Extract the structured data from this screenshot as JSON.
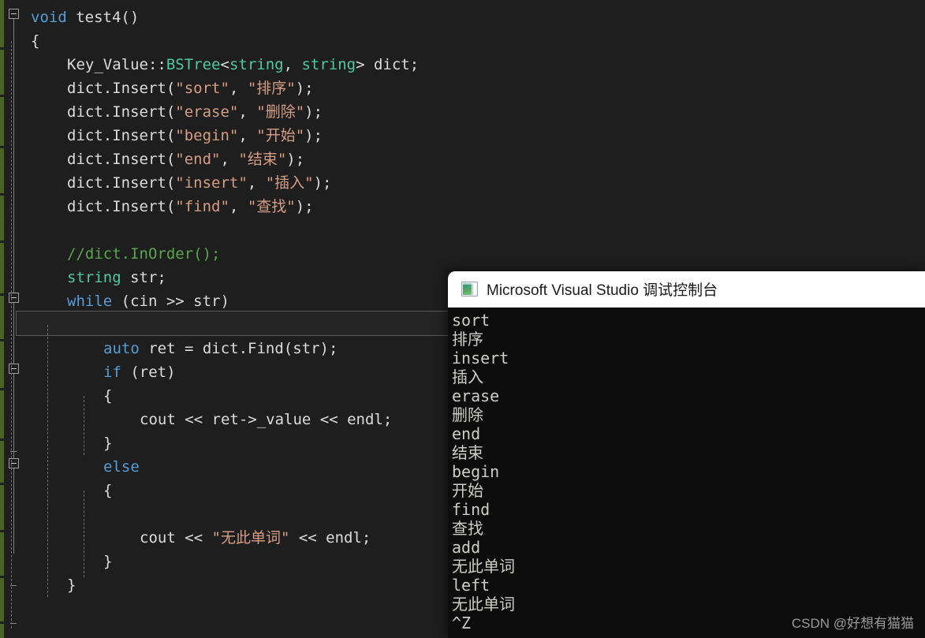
{
  "editor": {
    "name": "visual-studio-code-editor",
    "theme_colors": {
      "background": "#1e1e1e",
      "keyword": "#569cd6",
      "type": "#4ec9a0",
      "string": "#d69d85",
      "comment": "#57a64a",
      "plain": "#dcdcdc",
      "change_bar": "#4b6226",
      "current_line_border": "#5a5a5a"
    },
    "lines": [
      {
        "indent": 0,
        "tokens": [
          {
            "t": "void",
            "c": "kw"
          },
          {
            "t": " test4()",
            "c": "pln"
          }
        ]
      },
      {
        "indent": 0,
        "tokens": [
          {
            "t": "{",
            "c": "brc"
          }
        ]
      },
      {
        "indent": 1,
        "tokens": [
          {
            "t": "Key_Value::",
            "c": "pln"
          },
          {
            "t": "BSTree",
            "c": "typ"
          },
          {
            "t": "<",
            "c": "pln"
          },
          {
            "t": "string",
            "c": "typ"
          },
          {
            "t": ", ",
            "c": "pln"
          },
          {
            "t": "string",
            "c": "typ"
          },
          {
            "t": "> dict;",
            "c": "pln"
          }
        ]
      },
      {
        "indent": 1,
        "tokens": [
          {
            "t": "dict.Insert(",
            "c": "pln"
          },
          {
            "t": "\"sort\"",
            "c": "str"
          },
          {
            "t": ", ",
            "c": "pln"
          },
          {
            "t": "\"排序\"",
            "c": "str"
          },
          {
            "t": ");",
            "c": "pln"
          }
        ]
      },
      {
        "indent": 1,
        "tokens": [
          {
            "t": "dict.Insert(",
            "c": "pln"
          },
          {
            "t": "\"erase\"",
            "c": "str"
          },
          {
            "t": ", ",
            "c": "pln"
          },
          {
            "t": "\"删除\"",
            "c": "str"
          },
          {
            "t": ");",
            "c": "pln"
          }
        ]
      },
      {
        "indent": 1,
        "tokens": [
          {
            "t": "dict.Insert(",
            "c": "pln"
          },
          {
            "t": "\"begin\"",
            "c": "str"
          },
          {
            "t": ", ",
            "c": "pln"
          },
          {
            "t": "\"开始\"",
            "c": "str"
          },
          {
            "t": ");",
            "c": "pln"
          }
        ]
      },
      {
        "indent": 1,
        "tokens": [
          {
            "t": "dict.Insert(",
            "c": "pln"
          },
          {
            "t": "\"end\"",
            "c": "str"
          },
          {
            "t": ", ",
            "c": "pln"
          },
          {
            "t": "\"结束\"",
            "c": "str"
          },
          {
            "t": ");",
            "c": "pln"
          }
        ]
      },
      {
        "indent": 1,
        "tokens": [
          {
            "t": "dict.Insert(",
            "c": "pln"
          },
          {
            "t": "\"insert\"",
            "c": "str"
          },
          {
            "t": ", ",
            "c": "pln"
          },
          {
            "t": "\"插入\"",
            "c": "str"
          },
          {
            "t": ");",
            "c": "pln"
          }
        ]
      },
      {
        "indent": 1,
        "tokens": [
          {
            "t": "dict.Insert(",
            "c": "pln"
          },
          {
            "t": "\"find\"",
            "c": "str"
          },
          {
            "t": ", ",
            "c": "pln"
          },
          {
            "t": "\"查找\"",
            "c": "str"
          },
          {
            "t": ");",
            "c": "pln"
          }
        ]
      },
      {
        "indent": 0,
        "tokens": []
      },
      {
        "indent": 1,
        "tokens": [
          {
            "t": "//dict.InOrder();",
            "c": "cmt"
          }
        ]
      },
      {
        "indent": 1,
        "tokens": [
          {
            "t": "string",
            "c": "typ"
          },
          {
            "t": " str;",
            "c": "pln"
          }
        ]
      },
      {
        "indent": 1,
        "tokens": [
          {
            "t": "while",
            "c": "kw"
          },
          {
            "t": " (cin >> str)",
            "c": "pln"
          }
        ]
      },
      {
        "indent": 1,
        "tokens": [
          {
            "t": "{",
            "c": "brc"
          }
        ]
      },
      {
        "indent": 2,
        "tokens": [
          {
            "t": "auto",
            "c": "kw"
          },
          {
            "t": " ret = dict.Find(str);",
            "c": "pln"
          }
        ]
      },
      {
        "indent": 2,
        "tokens": [
          {
            "t": "if",
            "c": "kw"
          },
          {
            "t": " (ret)",
            "c": "pln"
          }
        ]
      },
      {
        "indent": 2,
        "tokens": [
          {
            "t": "{",
            "c": "brc"
          }
        ]
      },
      {
        "indent": 3,
        "tokens": [
          {
            "t": "cout << ret->_value << endl;",
            "c": "pln"
          }
        ]
      },
      {
        "indent": 2,
        "tokens": [
          {
            "t": "}",
            "c": "brc"
          }
        ]
      },
      {
        "indent": 2,
        "tokens": [
          {
            "t": "else",
            "c": "kw"
          }
        ]
      },
      {
        "indent": 2,
        "tokens": [
          {
            "t": "{",
            "c": "brc"
          }
        ]
      },
      {
        "indent": 0,
        "tokens": []
      },
      {
        "indent": 3,
        "tokens": [
          {
            "t": "cout << ",
            "c": "pln"
          },
          {
            "t": "\"无此单词\"",
            "c": "str"
          },
          {
            "t": " << endl;",
            "c": "pln"
          }
        ]
      },
      {
        "indent": 2,
        "tokens": [
          {
            "t": "}",
            "c": "brc"
          }
        ]
      },
      {
        "indent": 1,
        "tokens": [
          {
            "t": "}",
            "c": "brc"
          }
        ]
      }
    ],
    "current_line_index": 13,
    "collapse_boxes": [
      0,
      12,
      15,
      19
    ],
    "fold_marker_icon": "collapse-minus-icon"
  },
  "console": {
    "title": "Microsoft Visual Studio 调试控制台",
    "icon": "console-window-icon",
    "background": "#0c0c0c",
    "text_color": "#ccccc8",
    "output_lines": [
      "sort",
      "排序",
      "insert",
      "插入",
      "erase",
      "删除",
      "end",
      "结束",
      "begin",
      "开始",
      "find",
      "查找",
      "add",
      "无此单词",
      "left",
      "无此单词",
      "^Z"
    ]
  },
  "watermark": {
    "text": "CSDN @好想有猫猫"
  }
}
